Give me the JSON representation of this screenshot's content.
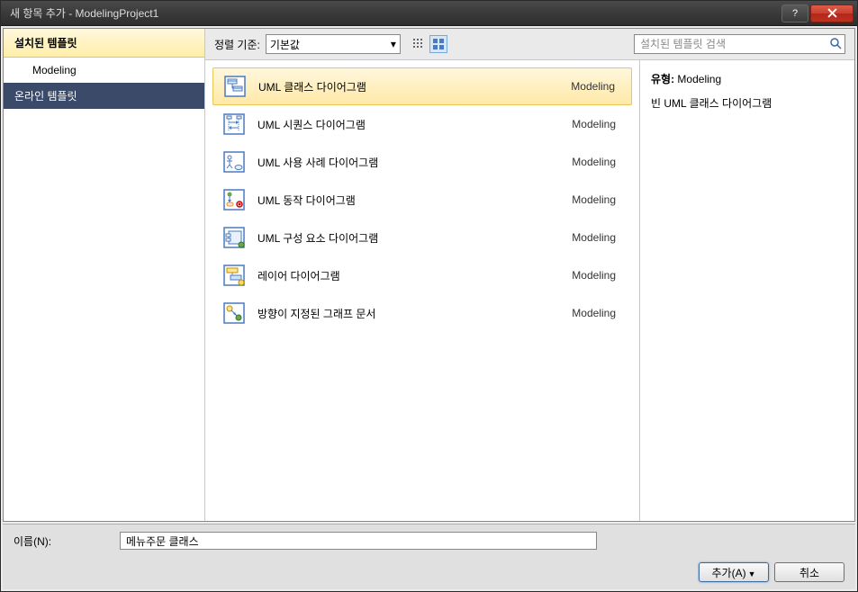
{
  "window": {
    "title": "새 항목 추가 - ModelingProject1"
  },
  "sidebar": {
    "installed_header": "설치된 템플릿",
    "items": [
      {
        "label": "Modeling"
      }
    ],
    "online_header": "온라인 템플릿"
  },
  "toolbar": {
    "sort_label": "정렬 기준:",
    "sort_value": "기본값",
    "search_placeholder": "설치된 템플릿 검색"
  },
  "templates": [
    {
      "name": "UML 클래스 다이어그램",
      "category": "Modeling",
      "selected": true,
      "icon": "class"
    },
    {
      "name": "UML 시퀀스 다이어그램",
      "category": "Modeling",
      "selected": false,
      "icon": "sequence"
    },
    {
      "name": "UML 사용 사례 다이어그램",
      "category": "Modeling",
      "selected": false,
      "icon": "usecase"
    },
    {
      "name": "UML 동작 다이어그램",
      "category": "Modeling",
      "selected": false,
      "icon": "activity"
    },
    {
      "name": "UML 구성 요소 다이어그램",
      "category": "Modeling",
      "selected": false,
      "icon": "component"
    },
    {
      "name": "레이어 다이어그램",
      "category": "Modeling",
      "selected": false,
      "icon": "layer"
    },
    {
      "name": "방향이 지정된 그래프 문서",
      "category": "Modeling",
      "selected": false,
      "icon": "graph"
    }
  ],
  "detail": {
    "type_label": "유형:",
    "type_value": "Modeling",
    "description": "빈 UML 클래스 다이어그램"
  },
  "bottom": {
    "name_label": "이름(N):",
    "name_value": "메뉴주문 클래스",
    "add_button": "추가(A)",
    "cancel_button": "취소"
  }
}
